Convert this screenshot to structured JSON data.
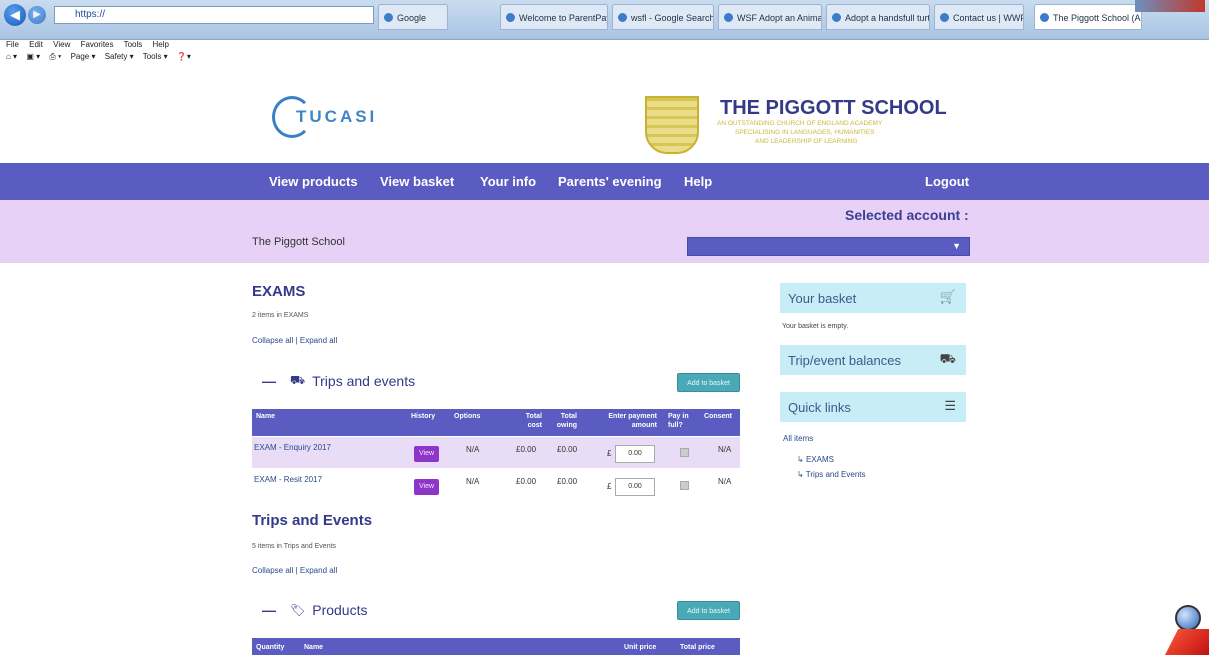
{
  "browser": {
    "address_text": "https://",
    "tabs": [
      {
        "label": "Google"
      },
      {
        "label": "Welcome to ParentPay"
      },
      {
        "label": "wsfl - Google Search"
      },
      {
        "label": "WSF Adopt an Animal"
      },
      {
        "label": "Adopt a handsfull turtle"
      },
      {
        "label": "Contact us | WWF"
      },
      {
        "label": "The Piggott School (A...",
        "active": true
      }
    ],
    "menu": [
      "File",
      "Edit",
      "View",
      "Favorites",
      "Tools",
      "Help"
    ],
    "toolbar": [
      "Page ▾",
      "Safety ▾",
      "Tools ▾"
    ]
  },
  "header": {
    "tucasi_logo": "TUCASI",
    "school_title": "THE PIGGOTT SCHOOL",
    "school_tagline": [
      "AN OUTSTANDING CHURCH of ENGLAND ACADEMY",
      "SPECIALISING IN LANGUAGES, HUMANITIES",
      "AND LEADERSHIP of LEARNING"
    ]
  },
  "nav": {
    "items": [
      "View products",
      "View basket",
      "Your info",
      "Parents' evening",
      "Help"
    ],
    "logout": "Logout"
  },
  "account": {
    "selected_label": "Selected account :",
    "org_name": "The Piggott School"
  },
  "exams": {
    "heading": "EXAMS",
    "count_text": "2 items in EXAMS",
    "collapse": "Collapse all",
    "sep": " | ",
    "expand": "Expand all",
    "section_title": "Trips and events",
    "add_button": "Add to basket",
    "columns": [
      "Name",
      "History",
      "Options",
      "Total cost",
      "Total owing",
      "Enter payment amount",
      "Pay in full?",
      "Consent"
    ],
    "rows": [
      {
        "name": "EXAM - Enquiry 2017",
        "history": "View",
        "options": "N/A",
        "total_cost": "£0.00",
        "total_owing": "£0.00",
        "currency": "£",
        "amount": "0.00",
        "consent": "N/A"
      },
      {
        "name": "EXAM - Resit 2017",
        "history": "View",
        "options": "N/A",
        "total_cost": "£0.00",
        "total_owing": "£0.00",
        "currency": "£",
        "amount": "0.00",
        "consent": "N/A"
      }
    ]
  },
  "trips": {
    "heading": "Trips and Events",
    "count_text": "5 items in Trips and Events",
    "collapse": "Collapse all",
    "sep": " | ",
    "expand": "Expand all",
    "section_title": "Products",
    "add_button": "Add to basket",
    "columns": [
      "Quantity",
      "Name",
      "Unit price",
      "Total price"
    ]
  },
  "sidebar": {
    "basket_title": "Your basket",
    "basket_empty": "Your basket is empty.",
    "balances_title": "Trip/event balances",
    "quicklinks_title": "Quick links",
    "all_items": "All items",
    "links": [
      "EXAMS",
      "Trips and Events"
    ]
  }
}
